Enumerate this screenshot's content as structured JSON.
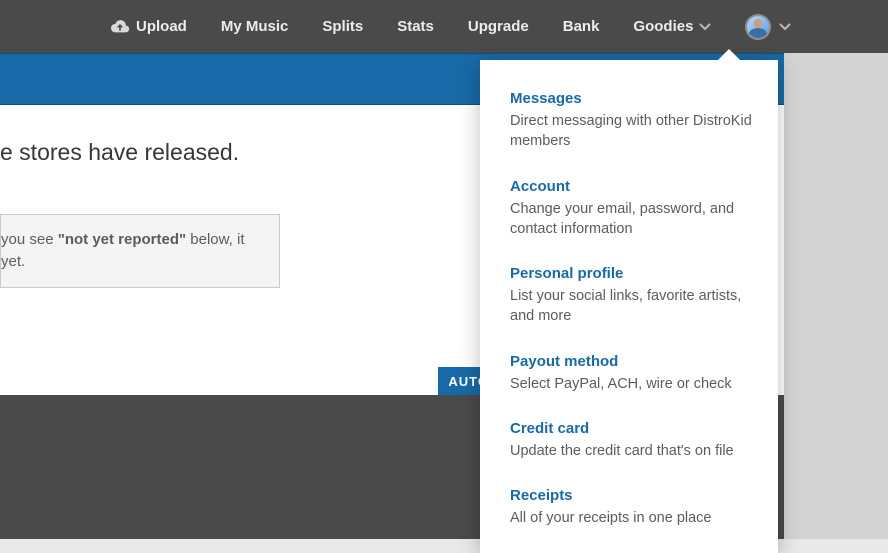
{
  "nav": {
    "upload": "Upload",
    "mymusic": "My Music",
    "splits": "Splits",
    "stats": "Stats",
    "upgrade": "Upgrade",
    "bank": "Bank",
    "goodies": "Goodies"
  },
  "page": {
    "headline_fragment": "e stores have released.",
    "notice_line1_pre": " you see ",
    "notice_bold": "\"not yet reported\"",
    "notice_line1_post": " below, it",
    "notice_line2": " yet.",
    "auto_button": "AUTO"
  },
  "dropdown": {
    "items": [
      {
        "title": "Messages",
        "desc": "Direct messaging with other DistroKid members"
      },
      {
        "title": "Account",
        "desc": "Change your email, password, and contact information"
      },
      {
        "title": "Personal profile",
        "desc": "List your social links, favorite artists, and more"
      },
      {
        "title": "Payout method",
        "desc": "Select PayPal, ACH, wire or check"
      },
      {
        "title": "Credit card",
        "desc": "Update the credit card that's on file"
      },
      {
        "title": "Receipts",
        "desc": "All of your receipts in one place"
      }
    ]
  }
}
